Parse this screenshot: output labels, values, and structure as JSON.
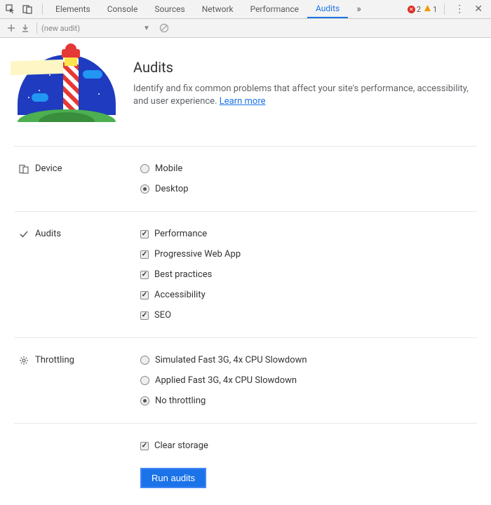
{
  "toolbar": {
    "tabs": [
      "Elements",
      "Console",
      "Sources",
      "Network",
      "Performance",
      "Audits"
    ],
    "active_tab": "Audits",
    "error_count": "2",
    "warning_count": "1"
  },
  "subbar": {
    "audit_placeholder": "(new audit)"
  },
  "hero": {
    "title": "Audits",
    "desc": "Identify and fix common problems that affect your site's performance, accessibility, and user experience. ",
    "link": "Learn more"
  },
  "sections": {
    "device": {
      "label": "Device",
      "options": [
        {
          "label": "Mobile",
          "checked": false
        },
        {
          "label": "Desktop",
          "checked": true
        }
      ]
    },
    "audits": {
      "label": "Audits",
      "options": [
        {
          "label": "Performance",
          "checked": true
        },
        {
          "label": "Progressive Web App",
          "checked": true
        },
        {
          "label": "Best practices",
          "checked": true
        },
        {
          "label": "Accessibility",
          "checked": true
        },
        {
          "label": "SEO",
          "checked": true
        }
      ]
    },
    "throttling": {
      "label": "Throttling",
      "options": [
        {
          "label": "Simulated Fast 3G, 4x CPU Slowdown",
          "checked": false
        },
        {
          "label": "Applied Fast 3G, 4x CPU Slowdown",
          "checked": false
        },
        {
          "label": "No throttling",
          "checked": true
        }
      ]
    },
    "clear_storage": {
      "label": "Clear storage",
      "checked": true
    }
  },
  "run_button": "Run audits"
}
